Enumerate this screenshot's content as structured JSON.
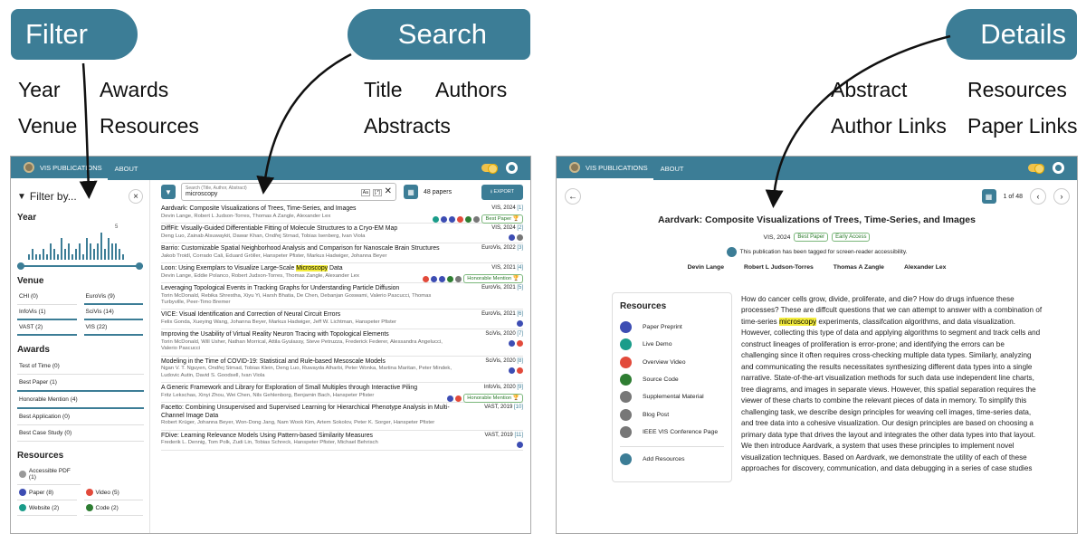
{
  "callouts": {
    "filter": "Filter",
    "search": "Search",
    "details": "Details"
  },
  "labels": {
    "year": "Year",
    "awards": "Awards",
    "venue": "Venue",
    "resources": "Resources",
    "title": "Title",
    "authors": "Authors",
    "abstracts": "Abstracts",
    "abstract": "Abstract",
    "resources2": "Resources",
    "author_links": "Author Links",
    "paper_links": "Paper Links"
  },
  "app": {
    "brand": "VIS PUBLICATIONS",
    "about": "ABOUT"
  },
  "sidebar": {
    "filter_by": "Filter by...",
    "close": "×",
    "year_title": "Year",
    "hist_peak": "5",
    "year_counts": [
      1,
      2,
      1,
      1,
      2,
      1,
      3,
      2,
      1,
      4,
      2,
      3,
      1,
      2,
      3,
      1,
      4,
      3,
      2,
      3,
      5,
      2,
      4,
      3,
      3,
      2,
      1
    ],
    "venue_title": "Venue",
    "venues": [
      {
        "label": "CHI (0)",
        "on": false
      },
      {
        "label": "EuroVis (9)",
        "on": true
      },
      {
        "label": "InfoVis (1)",
        "on": true
      },
      {
        "label": "SciVis (14)",
        "on": true
      },
      {
        "label": "VAST (2)",
        "on": true
      },
      {
        "label": "VIS (22)",
        "on": true
      }
    ],
    "awards_title": "Awards",
    "awards": [
      {
        "label": "Test of Time (0)",
        "on": false
      },
      {
        "label": "Best Paper (1)",
        "on": true
      },
      {
        "label": "Honorable Mention (4)",
        "on": true
      },
      {
        "label": "Best Application (0)",
        "on": false
      },
      {
        "label": "Best Case Study (0)",
        "on": false
      }
    ],
    "resources_title": "Resources",
    "resources": [
      {
        "label": "Accessible PDF (1)",
        "color": "#999999"
      },
      {
        "label": "Paper (8)",
        "color": "#3d4db3"
      },
      {
        "label": "Video (5)",
        "color": "#e24a3b"
      },
      {
        "label": "Website (2)",
        "color": "#1a9c8a"
      },
      {
        "label": "Code (2)",
        "color": "#2e7d32"
      }
    ]
  },
  "search": {
    "placeholder_label": "Search (Title, Author, Abstract)",
    "value": "microscopy",
    "case": "Aa",
    "regex": "[.*]",
    "clear": "✕",
    "count": "48 papers",
    "export": "EXPORT"
  },
  "papers": [
    {
      "title": "Aardvark: Composite Visualizations of Trees, Time-Series, and Images",
      "authors": "Devin Lange, Robert L Judson-Torres, Thomas A Zangle, Alexander Lex",
      "venue": "VIS, 2024",
      "idx": "[1]",
      "award": "Best Paper",
      "icons": [
        "#1a9c8a",
        "#3d4db3",
        "#3d4db3",
        "#e24a3b",
        "#2e7d32",
        "#777777"
      ]
    },
    {
      "title": "DiffFit: Visually-Guided Differentiable Fitting of Molecule Structures to a Cryo-EM Map",
      "authors": "Deng Luo, Zainab Alsuwaykit, Dawar Khan, Ondřej Strnad, Tobias Isenberg, Ivan Viola",
      "venue": "VIS, 2024",
      "idx": "[2]",
      "award": "",
      "icons": [
        "#3d4db3",
        "#777777"
      ]
    },
    {
      "title": "Barrio: Customizable Spatial Neighborhood Analysis and Comparison for Nanoscale Brain Structures",
      "authors": "Jakob Troidl, Corrado Cali, Eduard Gröller, Hanspeter Pfister, Markus Hadwiger, Johanna Beyer",
      "venue": "EuroVis, 2022",
      "idx": "[3]",
      "award": "",
      "icons": []
    },
    {
      "title": "Loon: Using Exemplars to Visualize Large-Scale ",
      "hl": "Microscopy",
      "tail": " Data",
      "authors": "Devin Lange, Eddie Polanco, Robert Judson-Torres, Thomas Zangle, Alexander Lex",
      "venue": "VIS, 2021",
      "idx": "[4]",
      "award": "Honorable Mention",
      "icons": [
        "#e24a3b",
        "#3d4db3",
        "#3d4db3",
        "#2e7d32",
        "#777777"
      ]
    },
    {
      "title": "Leveraging Topological Events in Tracking Graphs for Understanding Particle Diffusion",
      "authors": "Torin McDonald, Rebika Shrestha, Xiyu Yi, Harsh Bhatia, De Chen, Debanjan Goswami, Valerio Pascucci, Thomas Turbyville, Peer-Timo Bremer",
      "venue": "EuroVis, 2021",
      "idx": "[5]",
      "award": "",
      "icons": []
    },
    {
      "title": "VICE: Visual Identification and Correction of Neural Circuit Errors",
      "authors": "Felix Gonda, Xueying Wang, Johanna Beyer, Markus Hadwiger, Jeff W. Lichtman, Hanspeter Pfister",
      "venue": "EuroVis, 2021",
      "idx": "[6]",
      "award": "",
      "icons": [
        "#3d4db3"
      ]
    },
    {
      "title": "Improving the Usability of Virtual Reality Neuron Tracing with Topological Elements",
      "authors": "Torin McDonald, Will Usher, Nathan Morrical, Attila Gyulassy, Steve Petruzza, Frederick Federer, Alessandra Angelucci, Valerio Pascucci",
      "venue": "SciVis, 2020",
      "idx": "[7]",
      "award": "",
      "icons": [
        "#3d4db3",
        "#e24a3b"
      ]
    },
    {
      "title": "Modeling in the Time of COVID-19: Statistical and Rule-based Mesoscale Models",
      "authors": "Ngan V. T. Nguyen, Ondřej Strnad, Tobias Klein, Deng Luo, Ruwayda Alharbi, Peter Wonka, Martina Maritan, Peter Mindek, Ludovic Autin, David S. Goodsell, Ivan Viola",
      "venue": "SciVis, 2020",
      "idx": "[8]",
      "award": "",
      "icons": [
        "#3d4db3",
        "#e24a3b"
      ]
    },
    {
      "title": "A Generic Framework and Library for Exploration of Small Multiples through Interactive Piling",
      "authors": "Fritz Lekschas, Xinyi Zhou, Wei Chen, Nils Gehlenborg, Benjamin Bach, Hanspeter Pfister",
      "venue": "InfoVis, 2020",
      "idx": "[9]",
      "award": "Honorable Mention",
      "icons": [
        "#3d4db3",
        "#e24a3b"
      ]
    },
    {
      "title": "Facetto: Combining Unsupervised and Supervised Learning for Hierarchical Phenotype Analysis in Multi-Channel Image Data",
      "authors": "Robert Krüger, Johanna Beyer, Won-Dong Jang, Nam Wook Kim, Artem Sokolov, Peter K. Sorger, Hanspeter Pfister",
      "venue": "VAST, 2019",
      "idx": "[10]",
      "award": "",
      "icons": []
    },
    {
      "title": "FDive: Learning Relevance Models Using Pattern-based Similarity Measures",
      "authors": "Frederik L. Dennig, Tom Polk, Zudi Lin, Tobias Schreck, Hanspeter Pfister, Michael Behrisch",
      "venue": "VAST, 2019",
      "idx": "[11]",
      "award": "",
      "icons": [
        "#3d4db3"
      ]
    }
  ],
  "detail": {
    "back": "←",
    "pager": "1 of 48",
    "prev": "‹",
    "next": "›",
    "title": "Aardvark: Composite Visualizations of Trees, Time-Series, and Images",
    "venue": "VIS, 2024",
    "award": "Best Paper",
    "access": "Early Access",
    "a11y": "This publication has been tagged for screen-reader accessibility.",
    "authors": [
      "Devin Lange",
      "Robert L Judson-Torres",
      "Thomas A Zangle",
      "Alexander Lex"
    ],
    "resources_title": "Resources",
    "resources": [
      {
        "label": "Paper Preprint",
        "color": "#3d4db3"
      },
      {
        "label": "Live Demo",
        "color": "#1a9c8a"
      },
      {
        "label": "Overview Video",
        "color": "#e24a3b"
      },
      {
        "label": "Source Code",
        "color": "#2e7d32"
      },
      {
        "label": "Supplemental Material",
        "color": "#777777"
      },
      {
        "label": "Blog Post",
        "color": "#777777"
      },
      {
        "label": "IEEE VIS Conference Page",
        "color": "#777777"
      }
    ],
    "add_resources": "Add Resources",
    "abstract_pre": "How do cancer cells grow, divide, proliferate, and die? How do drugs infuence these processes? These are diffcult questions that we can attempt to answer with a combination of time-series ",
    "abstract_hl": "microscopy",
    "abstract_post": " experiments, classifcation algorithms, and data visualization. However, collecting this type of data and applying algorithms to segment and track cells and construct lineages of proliferation is error-prone; and identifying the errors can be challenging since it often requires cross-checking multiple data types. Similarly, analyzing and communicating the results necessitates synthesizing different data types into a single narrative. State-of-the-art visualization methods for such data use independent line charts, tree diagrams, and images in separate views. However, this spatial separation requires the viewer of these charts to combine the relevant pieces of data in memory. To simplify this challenging task, we describe design principles for weaving cell images, time-series data, and tree data into a cohesive visualization. Our design principles are based on choosing a primary data type that drives the layout and integrates the other data types into that layout. We then introduce Aardvark, a system that uses these principles to implement novel visualization techniques. Based on Aardvark, we demonstrate the utility of each of these approaches for discovery, communication, and data debugging in a series of case studies"
  }
}
